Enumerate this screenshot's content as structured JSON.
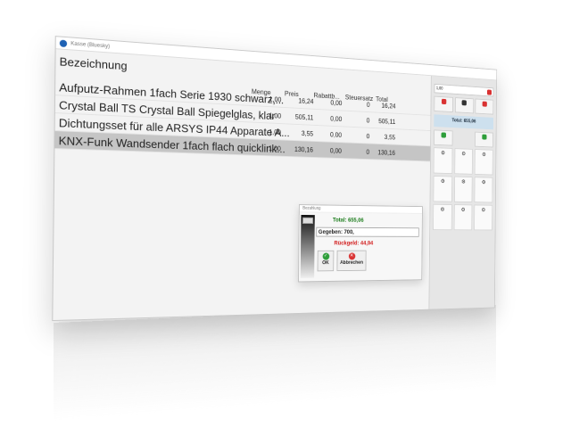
{
  "window": {
    "title": "Kasse (Bluesky)"
  },
  "table": {
    "columns": {
      "name": "Bezeichnung",
      "quantity": "Menge",
      "price": "Preis",
      "discount": "Rabattb...",
      "tax": "Steuersatz",
      "total": "Total"
    },
    "rows": [
      {
        "name": "Aufputz-Rahmen 1fach Serie 1930 schwarz,...",
        "quantity": "1,00",
        "price": "16,24",
        "discount": "0,00",
        "tax": "0",
        "total": "16,24"
      },
      {
        "name": "Crystal Ball TS Crystal Ball Spiegelglas, klar",
        "quantity": "1,00",
        "price": "505,11",
        "discount": "0,00",
        "tax": "0",
        "total": "505,11"
      },
      {
        "name": "Dichtungsset für alle ARSYS IP44 Apparate A...",
        "quantity": "1,00",
        "price": "3,55",
        "discount": "0,00",
        "tax": "0",
        "total": "3,55"
      },
      {
        "name": "KNX-Funk Wandsender 1fach flach quicklink...",
        "quantity": "1,00",
        "price": "130,16",
        "discount": "0,00",
        "tax": "0",
        "total": "130,16"
      }
    ]
  },
  "sidebar": {
    "total_label": "Total: 655,06",
    "input_value": "1,00"
  },
  "dialog": {
    "title": "Bezahlung",
    "total": "Total: 655,06",
    "given": "Gegeben: 700,",
    "change": "Rückgeld: 44,94",
    "ok_label": "OK",
    "cancel_label": "Abbrechen"
  },
  "colors": {
    "accent": "#1e62b4",
    "positive": "#1c7d1c",
    "negative": "#d32121",
    "selected_row": "#c5c5c5"
  }
}
